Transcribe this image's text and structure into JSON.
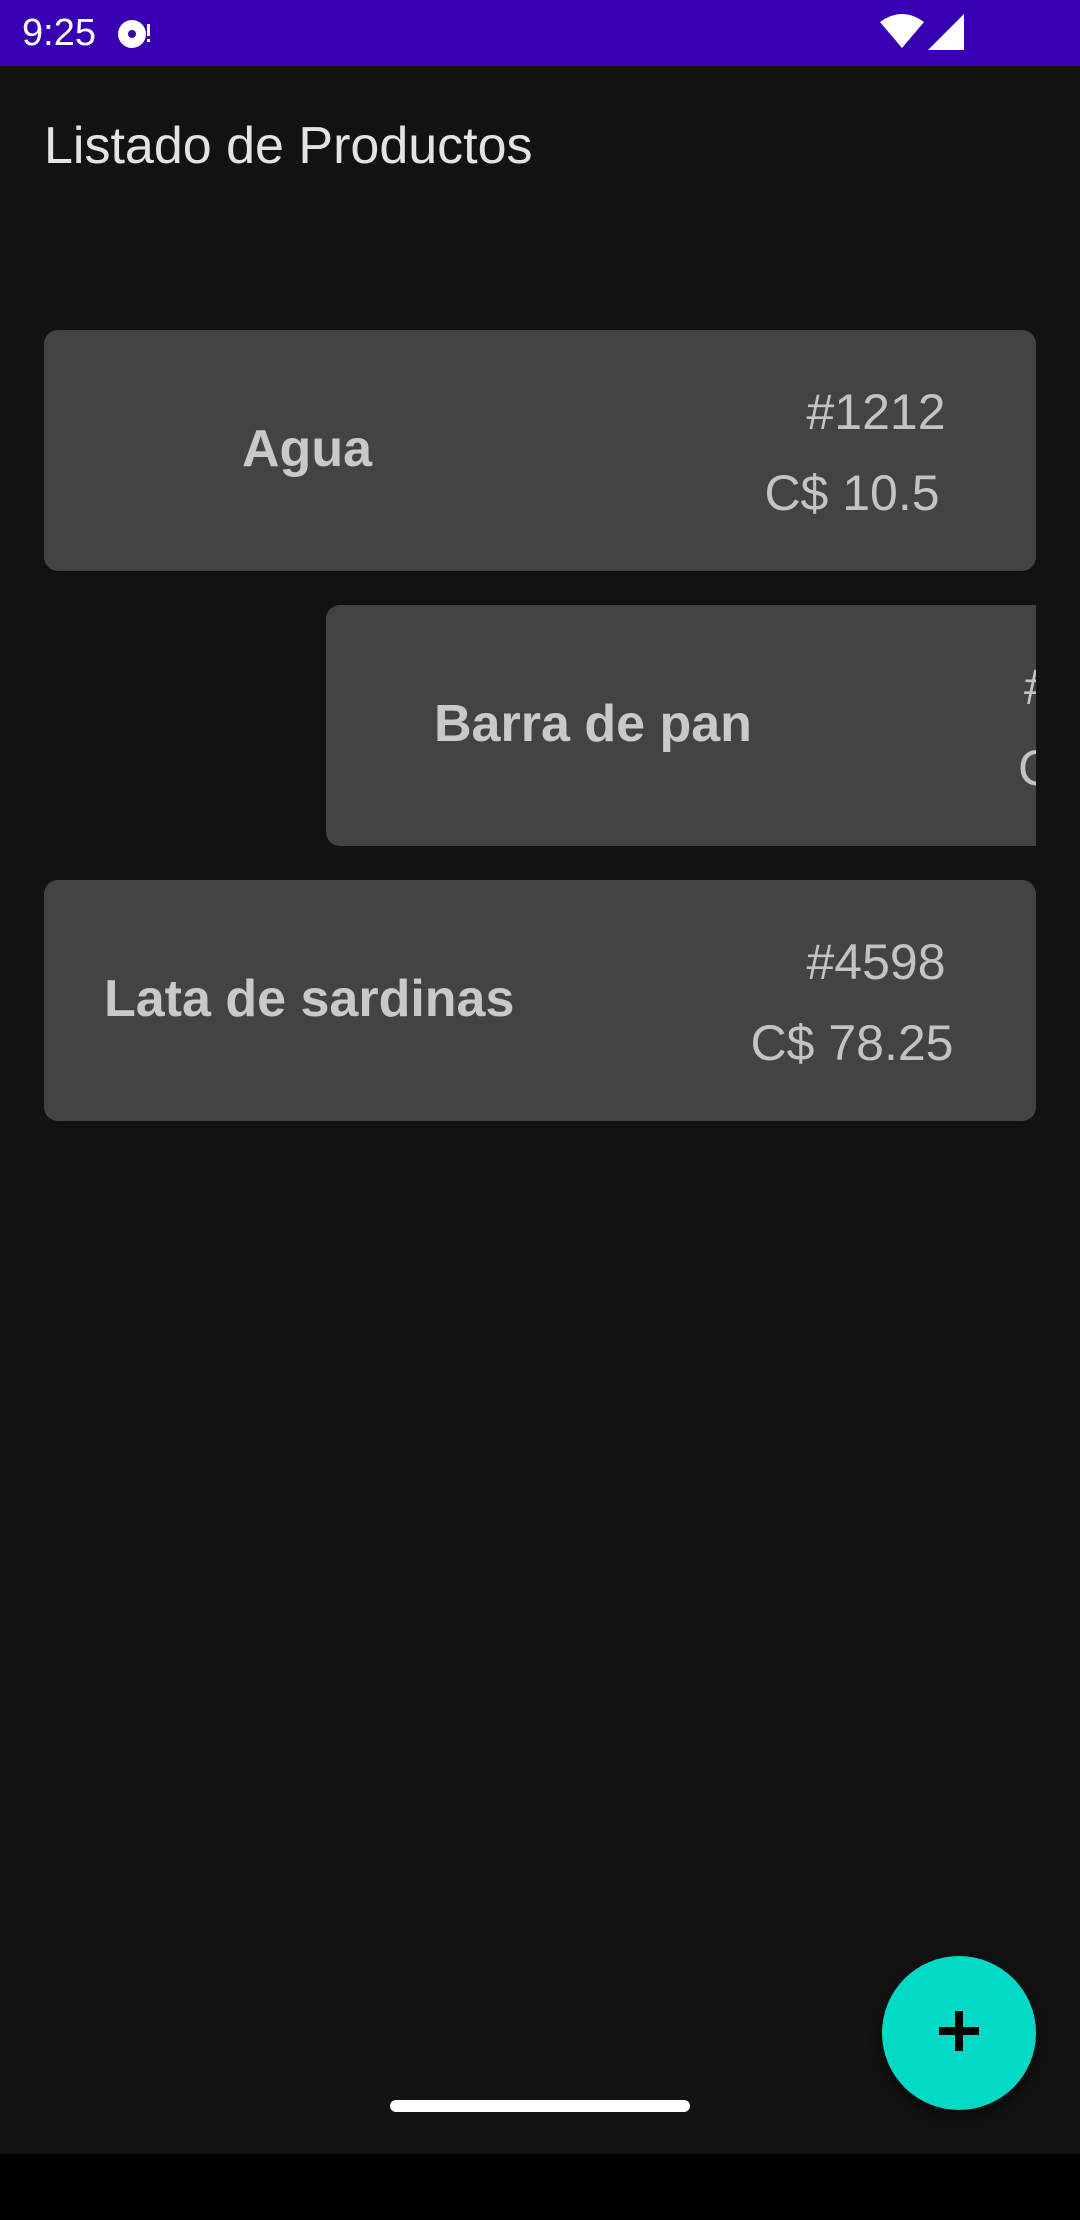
{
  "status_bar": {
    "time": "9:25",
    "color": "#3700b3",
    "icons": [
      "media-notification-icon",
      "wifi-icon",
      "signal-icon"
    ]
  },
  "header": {
    "title": "Listado de Productos"
  },
  "products": [
    {
      "name": "Agua",
      "number": "#1212",
      "price": "C$ 10.5"
    },
    {
      "name": "Barra de pan",
      "number": "#",
      "price": "C"
    },
    {
      "name": "Lata de sardinas",
      "number": "#4598",
      "price": "C$ 78.25"
    }
  ],
  "fab": {
    "icon": "plus-icon",
    "color": "#03dac5"
  },
  "theme": {
    "background": "#121212",
    "card": "#434343"
  }
}
